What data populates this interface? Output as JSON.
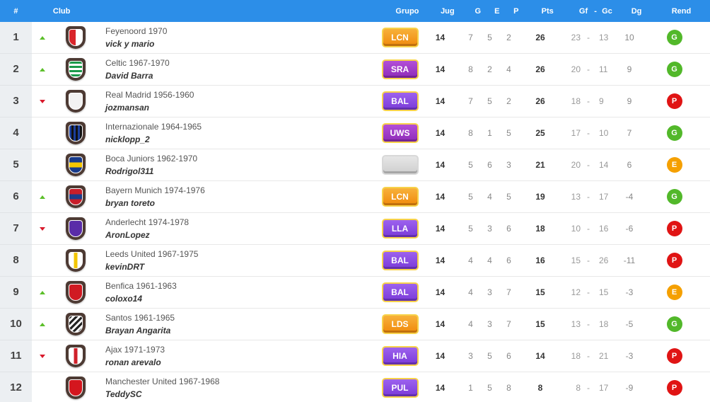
{
  "header": {
    "pos": "#",
    "club": "Club",
    "group": "Grupo",
    "played": "Jug",
    "won": "G",
    "drawn": "E",
    "lost": "P",
    "points": "Pts",
    "gf": "Gf",
    "dash": "-",
    "gc": "Gc",
    "dg": "Dg",
    "form": "Rend"
  },
  "colors": {
    "header_bg": "#2c8ee8",
    "up": "#5cbf2a",
    "down": "#d9192b",
    "rend_G": "#52b82a",
    "rend_P": "#e01414",
    "rend_E": "#f5a000",
    "badge_orange": "#f59a12",
    "badge_purple": "#a03cc8",
    "badge_violet": "#8a4ce0"
  },
  "rows": [
    {
      "pos": "1",
      "trend": "up",
      "club": "Feyenoord 1970",
      "manager": "vick y mario",
      "group": "LCN",
      "group_color": "orange",
      "played": "14",
      "won": "7",
      "drawn": "5",
      "lost": "2",
      "points": "26",
      "gf": "23",
      "gc": "13",
      "dg": "10",
      "form": "G",
      "shield_primary": "#d9252a",
      "shield_secondary": "#ffffff",
      "shield_pattern": "half"
    },
    {
      "pos": "2",
      "trend": "up",
      "club": "Celtic 1967-1970",
      "manager": "David Barra",
      "group": "SRA",
      "group_color": "purple",
      "played": "14",
      "won": "8",
      "drawn": "2",
      "lost": "4",
      "points": "26",
      "gf": "20",
      "gc": "11",
      "dg": "9",
      "form": "G",
      "shield_primary": "#1b9a4a",
      "shield_secondary": "#ffffff",
      "shield_pattern": "hoops"
    },
    {
      "pos": "3",
      "trend": "down",
      "club": "Real Madrid 1956-1960",
      "manager": "jozmansan",
      "group": "BAL",
      "group_color": "violet",
      "played": "14",
      "won": "7",
      "drawn": "5",
      "lost": "2",
      "points": "26",
      "gf": "18",
      "gc": "9",
      "dg": "9",
      "form": "P",
      "shield_primary": "#f2f2f2",
      "shield_secondary": "#dddddd",
      "shield_pattern": "solid"
    },
    {
      "pos": "4",
      "trend": "none",
      "club": "Internazionale 1964-1965",
      "manager": "nicklopp_2",
      "group": "UWS",
      "group_color": "purple",
      "played": "14",
      "won": "8",
      "drawn": "1",
      "lost": "5",
      "points": "25",
      "gf": "17",
      "gc": "10",
      "dg": "7",
      "form": "G",
      "shield_primary": "#1a3e9c",
      "shield_secondary": "#111111",
      "shield_pattern": "stripes"
    },
    {
      "pos": "5",
      "trend": "none",
      "club": "Boca Juniors 1962-1970",
      "manager": "Rodrigol311",
      "group": "",
      "group_color": "empty",
      "played": "14",
      "won": "5",
      "drawn": "6",
      "lost": "3",
      "points": "21",
      "gf": "20",
      "gc": "14",
      "dg": "6",
      "form": "E",
      "shield_primary": "#173a8a",
      "shield_secondary": "#f5c500",
      "shield_pattern": "band"
    },
    {
      "pos": "6",
      "trend": "up",
      "club": "Bayern Munich 1974-1976",
      "manager": "bryan toreto",
      "group": "LCN",
      "group_color": "orange",
      "played": "14",
      "won": "5",
      "drawn": "4",
      "lost": "5",
      "points": "19",
      "gf": "13",
      "gc": "17",
      "dg": "-4",
      "form": "G",
      "shield_primary": "#c81e2a",
      "shield_secondary": "#1d3c8a",
      "shield_pattern": "band"
    },
    {
      "pos": "7",
      "trend": "down",
      "club": "Anderlecht 1974-1978",
      "manager": "AronLopez",
      "group": "LLA",
      "group_color": "violet",
      "played": "14",
      "won": "5",
      "drawn": "3",
      "lost": "6",
      "points": "18",
      "gf": "10",
      "gc": "16",
      "dg": "-6",
      "form": "P",
      "shield_primary": "#5a2ca8",
      "shield_secondary": "#5a2ca8",
      "shield_pattern": "solid"
    },
    {
      "pos": "8",
      "trend": "none",
      "club": "Leeds United 1967-1975",
      "manager": "kevinDRT",
      "group": "BAL",
      "group_color": "violet",
      "played": "14",
      "won": "4",
      "drawn": "4",
      "lost": "6",
      "points": "16",
      "gf": "15",
      "gc": "26",
      "dg": "-11",
      "form": "P",
      "shield_primary": "#ffffff",
      "shield_secondary": "#f2c500",
      "shield_pattern": "center"
    },
    {
      "pos": "9",
      "trend": "up",
      "club": "Benfica 1961-1963",
      "manager": "coloxo14",
      "group": "BAL",
      "group_color": "violet",
      "played": "14",
      "won": "4",
      "drawn": "3",
      "lost": "7",
      "points": "15",
      "gf": "12",
      "gc": "15",
      "dg": "-3",
      "form": "E",
      "shield_primary": "#d01a22",
      "shield_secondary": "#d01a22",
      "shield_pattern": "solid"
    },
    {
      "pos": "10",
      "trend": "up",
      "club": "Santos 1961-1965",
      "manager": "Brayan Angarita",
      "group": "LDS",
      "group_color": "orange",
      "played": "14",
      "won": "4",
      "drawn": "3",
      "lost": "7",
      "points": "15",
      "gf": "13",
      "gc": "18",
      "dg": "-5",
      "form": "G",
      "shield_primary": "#ffffff",
      "shield_secondary": "#222222",
      "shield_pattern": "diagonal"
    },
    {
      "pos": "11",
      "trend": "down",
      "club": "Ajax 1971-1973",
      "manager": "ronan arevalo",
      "group": "HIA",
      "group_color": "violet",
      "played": "14",
      "won": "3",
      "drawn": "5",
      "lost": "6",
      "points": "14",
      "gf": "18",
      "gc": "21",
      "dg": "-3",
      "form": "P",
      "shield_primary": "#ffffff",
      "shield_secondary": "#d0202a",
      "shield_pattern": "center"
    },
    {
      "pos": "12",
      "trend": "none",
      "club": "Manchester United 1967-1968",
      "manager": "TeddySC",
      "group": "PUL",
      "group_color": "violet",
      "played": "14",
      "won": "1",
      "drawn": "5",
      "lost": "8",
      "points": "8",
      "gf": "8",
      "gc": "17",
      "dg": "-9",
      "form": "P",
      "shield_primary": "#d4161e",
      "shield_secondary": "#d4161e",
      "shield_pattern": "solid"
    }
  ]
}
